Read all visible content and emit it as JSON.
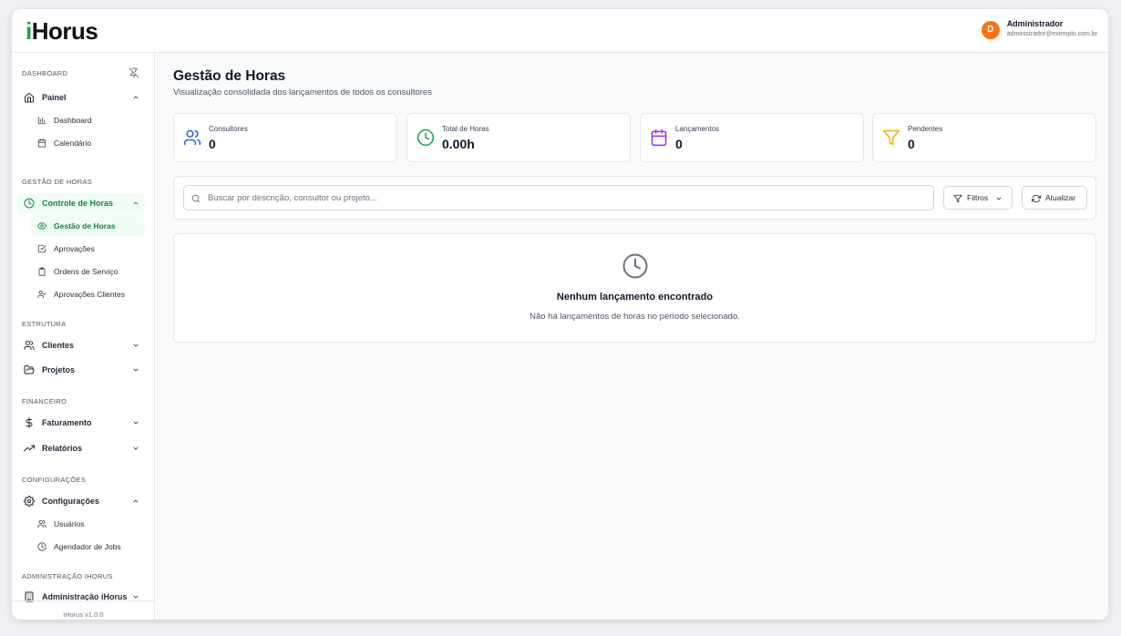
{
  "app": {
    "logo": "iHorus",
    "logo_accent": "i",
    "logo_rest": "Horus",
    "version": "iHorus v1.0.0"
  },
  "user": {
    "initial": "D",
    "name": "Administrador",
    "email": "administrador@exemplo.com.br"
  },
  "sidebar": {
    "sections": {
      "dashboard": "DASHBOARD",
      "gestao": "GESTÃO DE HORAS",
      "estrutura": "ESTRUTURA",
      "financeiro": "FINANCEIRO",
      "configuracoes": "CONFIGURAÇÕES",
      "admin": "ADMINISTRAÇÃO IHORUS"
    },
    "items": {
      "painel": "Painel",
      "dashboard": "Dashboard",
      "calendario": "Calendário",
      "controle": "Controle de Horas",
      "gestao_horas": "Gestão de Horas",
      "aprovacoes": "Aprovações",
      "ordens": "Ordens de Serviço",
      "aprov_clientes": "Aprovações Clientes",
      "clientes": "Clientes",
      "projetos": "Projetos",
      "faturamento": "Faturamento",
      "relatorios": "Relatórios",
      "configuracoes": "Configurações",
      "usuarios": "Usuários",
      "agendador": "Agendador de Jobs",
      "admin": "Administração iHorus"
    }
  },
  "page": {
    "title": "Gestão de Horas",
    "subtitle": "Visualização consolidada dos lançamentos de todos os consultores"
  },
  "stats": [
    {
      "label": "Consultores",
      "value": "0",
      "icon": "users-icon",
      "color": "#2563eb"
    },
    {
      "label": "Total de Horas",
      "value": "0.00h",
      "icon": "clock-icon",
      "color": "#16a34a"
    },
    {
      "label": "Lançamentos",
      "value": "0",
      "icon": "calendar-icon",
      "color": "#9333ea"
    },
    {
      "label": "Pendentes",
      "value": "0",
      "icon": "filter-icon",
      "color": "#eab308"
    }
  ],
  "search": {
    "placeholder": "Buscar por descrição, consultor ou projeto..."
  },
  "toolbar": {
    "filters_label": "Filtros",
    "refresh_label": "Atualizar"
  },
  "empty": {
    "title": "Nenhum lançamento encontrado",
    "subtitle": "Não há lançamentos de horas no período selecionado."
  },
  "colors": {
    "accent": "#16a34a",
    "accent_bg": "#f0fdf4",
    "avatar": "#f97316"
  }
}
